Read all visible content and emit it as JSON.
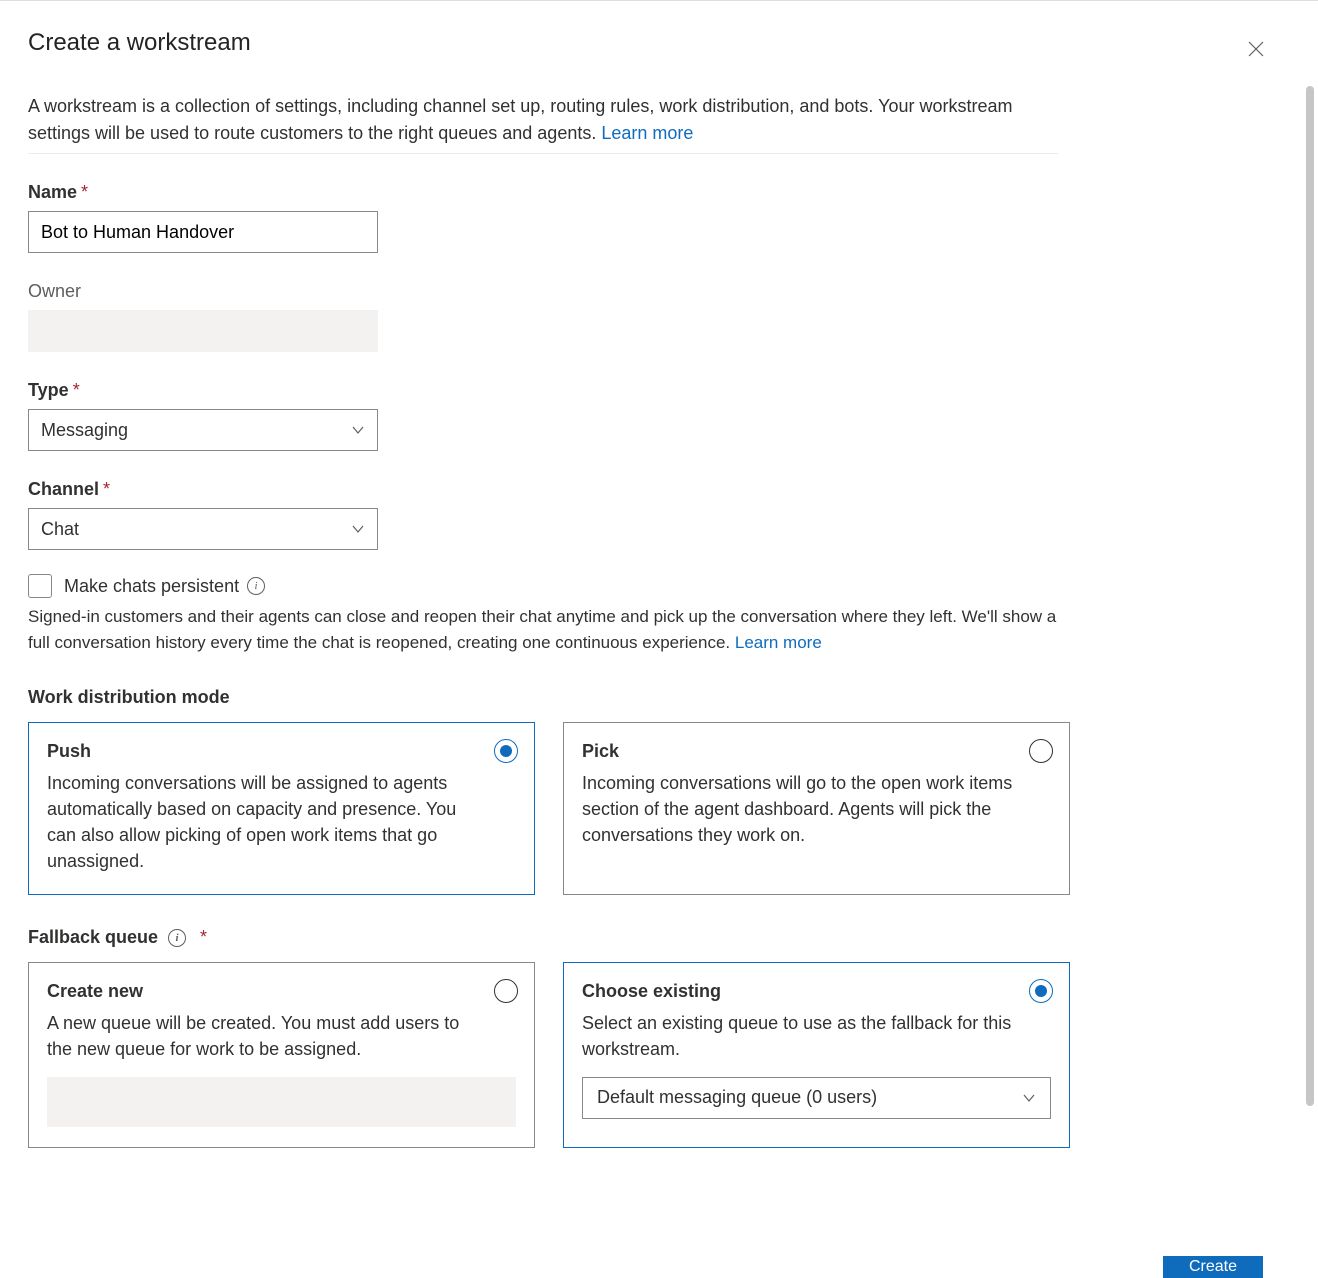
{
  "title": "Create a workstream",
  "description": "A workstream is a collection of settings, including channel set up, routing rules, work distribution, and bots. Your workstream settings will be used to route customers to the right queues and agents. ",
  "learn_more": "Learn more",
  "fields": {
    "name": {
      "label": "Name",
      "value": "Bot to Human Handover"
    },
    "owner": {
      "label": "Owner",
      "value": ""
    },
    "type": {
      "label": "Type",
      "value": "Messaging"
    },
    "channel": {
      "label": "Channel",
      "value": "Chat"
    }
  },
  "persistent": {
    "label": "Make chats persistent",
    "helper": "Signed-in customers and their agents can close and reopen their chat anytime and pick up the conversation where they left. We'll show a full conversation history every time the chat is reopened, creating one continuous experience. ",
    "learn_more": "Learn more"
  },
  "work_distribution": {
    "label": "Work distribution mode",
    "push": {
      "title": "Push",
      "body": "Incoming conversations will be assigned to agents automatically based on capacity and presence. You can also allow picking of open work items that go unassigned."
    },
    "pick": {
      "title": "Pick",
      "body": "Incoming conversations will go to the open work items section of the agent dashboard. Agents will pick the conversations they work on."
    }
  },
  "fallback": {
    "label": "Fallback queue",
    "create_new": {
      "title": "Create new",
      "body": "A new queue will be created. You must add users to the new queue for work to be assigned."
    },
    "choose_existing": {
      "title": "Choose existing",
      "body": "Select an existing queue to use as the fallback for this workstream.",
      "selected": "Default messaging queue (0 users)"
    }
  },
  "button": "Create"
}
